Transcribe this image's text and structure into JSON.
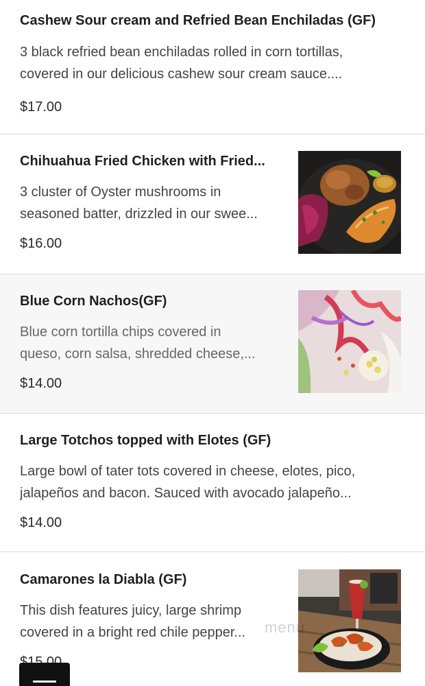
{
  "items": [
    {
      "title": "Cashew Sour cream and Refried Bean Enchiladas (GF)",
      "desc1": "3 black refried bean enchiladas rolled in corn tortillas,",
      "desc2": "covered in our delicious cashew sour cream sauce....",
      "price": "$17.00"
    },
    {
      "title": "Chihuahua Fried Chicken with Fried...",
      "desc1": "3 cluster of Oyster mushrooms in",
      "desc2": "seasoned batter, drizzled in our swee...",
      "price": "$16.00",
      "image": "fried-chicken-plate"
    },
    {
      "title": "Blue Corn Nachos(GF)",
      "desc1": "Blue corn tortilla chips covered in",
      "desc2": "queso, corn salsa, shredded cheese,...",
      "price": "$14.00",
      "image": "blue-corn-nachos-plate"
    },
    {
      "title": "Large Totchos topped with Elotes (GF)",
      "desc1": "Large bowl of tater tots covered in cheese, elotes, pico,",
      "desc2": "jalapeños and bacon. Sauced with avocado jalapeño...",
      "price": "$14.00"
    },
    {
      "title": "Camarones la Diabla (GF)",
      "desc1": "This dish features juicy, large shrimp",
      "desc2": "covered in a bright red chile pepper...",
      "price": "$15.00",
      "image": "camarones-diabla-plate"
    }
  ],
  "watermark": "menu",
  "menu_button_icon": "menu-list-icon"
}
